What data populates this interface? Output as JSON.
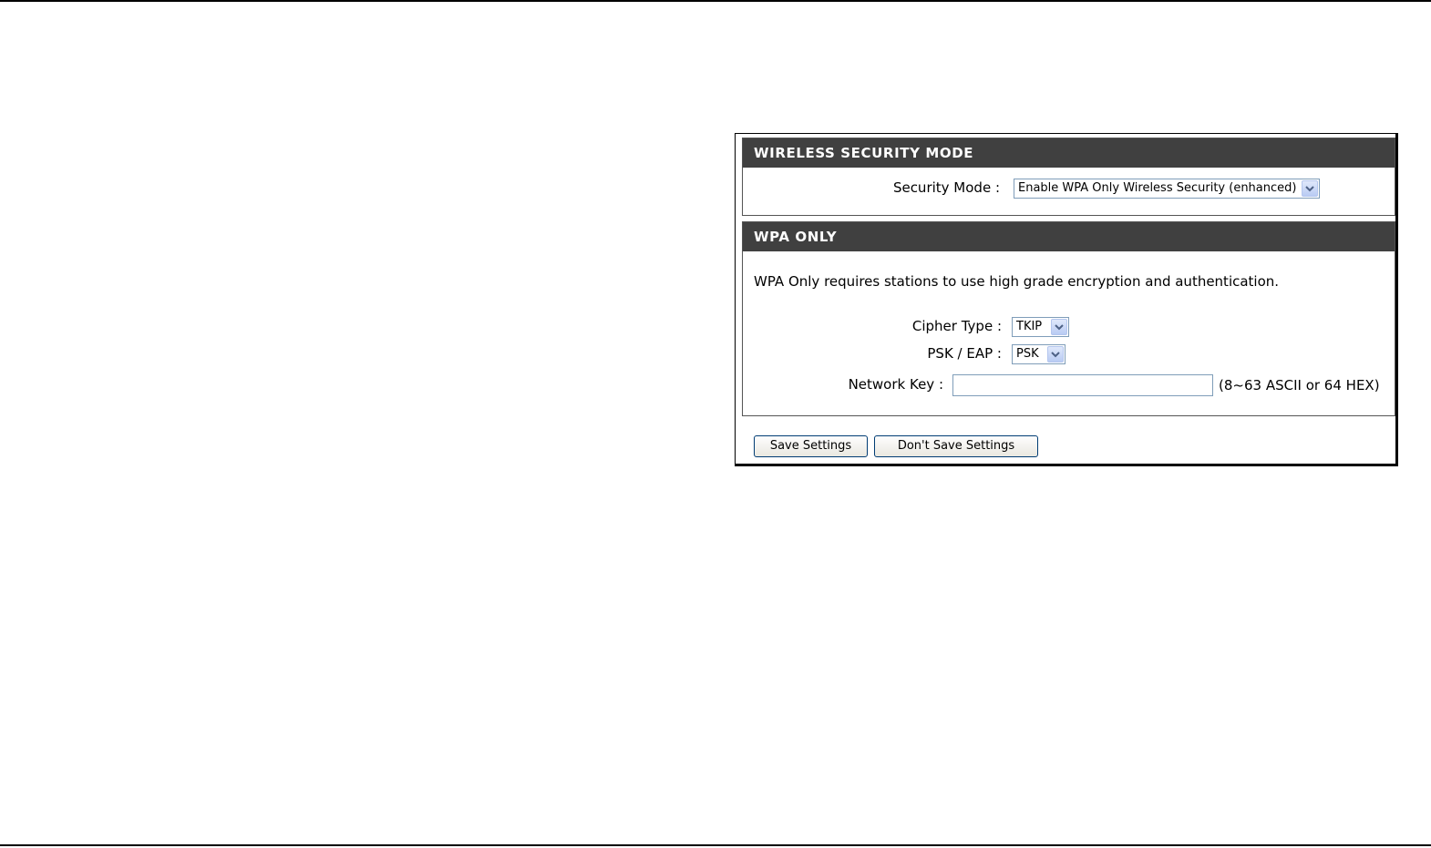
{
  "security_mode_section": {
    "title": "WIRELESS SECURITY MODE",
    "security_mode_label": "Security Mode :",
    "security_mode_value": "Enable WPA Only Wireless Security (enhanced)"
  },
  "wpa_only_section": {
    "title": "WPA ONLY",
    "description": "WPA Only requires stations to use high grade encryption and authentication.",
    "cipher_type_label": "Cipher Type :",
    "cipher_type_value": "TKIP",
    "psk_eap_label": "PSK / EAP :",
    "psk_eap_value": "PSK",
    "network_key_label": "Network Key :",
    "network_key_value": "",
    "network_key_hint": "(8~63 ASCII or 64 HEX)"
  },
  "buttons": {
    "save_label": "Save Settings",
    "dont_save_label": "Don't Save Settings"
  },
  "colors": {
    "header_bg": "#404040",
    "header_text": "#ffffff",
    "field_border": "#7f9db9",
    "button_border": "#003c74"
  }
}
